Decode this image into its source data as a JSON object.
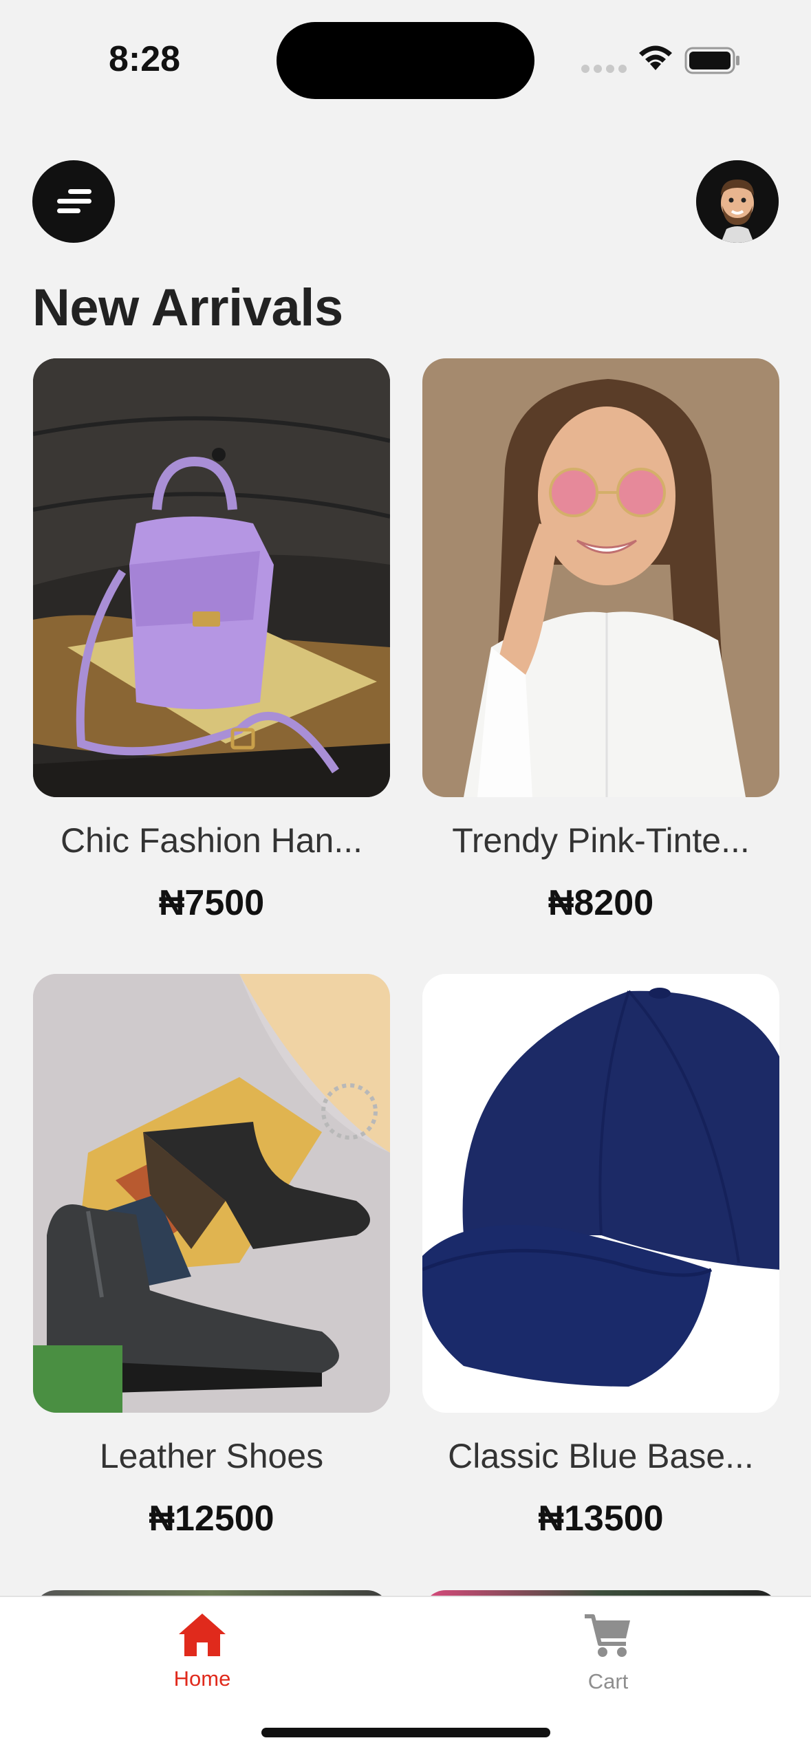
{
  "status_bar": {
    "time": "8:28"
  },
  "header": {
    "title": "New Arrivals"
  },
  "products": [
    {
      "name": "Chic Fashion Han...",
      "price": "₦7500",
      "image": "purple-handbag"
    },
    {
      "name": "Trendy Pink-Tinte...",
      "price": "₦8200",
      "image": "woman-pink-sunglasses"
    },
    {
      "name": "Leather Shoes",
      "price": "₦12500",
      "image": "black-chelsea-boots"
    },
    {
      "name": "Classic Blue Base...",
      "price": "₦13500",
      "image": "navy-baseball-cap"
    }
  ],
  "tabbar": {
    "home_label": "Home",
    "cart_label": "Cart",
    "active_color": "#e02a1c",
    "inactive_color": "#8e8e8e"
  },
  "icons": {
    "menu": "menu-lines-icon",
    "avatar": "memoji-avatar",
    "home": "home-icon",
    "cart": "cart-icon"
  }
}
